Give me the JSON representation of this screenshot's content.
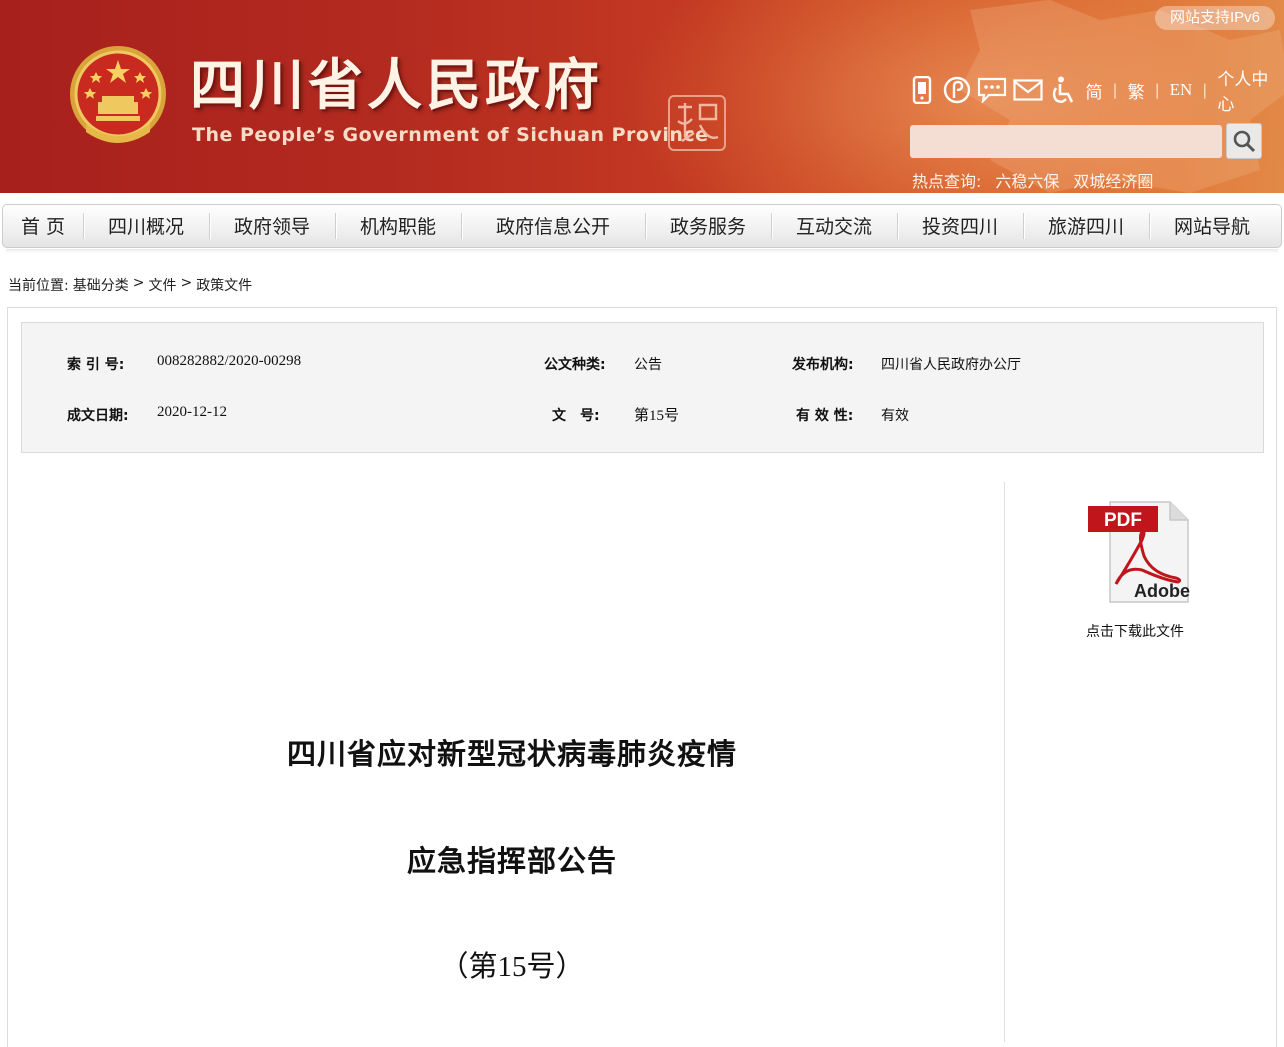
{
  "header": {
    "title": "四川省人民政府",
    "subtitle": "The People’s Government of Sichuan Province",
    "ipv6_badge": "网站支持IPv6",
    "tools": {
      "icons": [
        "mobile-icon",
        "weibo-icon",
        "wechat-icon",
        "mail-icon",
        "accessibility-icon"
      ],
      "lang_simplified": "简",
      "lang_traditional": "繁",
      "lang_english": "EN",
      "personal_center": "个人中心",
      "separator": "|"
    },
    "search": {
      "placeholder": ""
    },
    "hot": {
      "label": "热点查询:",
      "items": [
        "六稳六保",
        "双城经济圈"
      ]
    }
  },
  "nav": {
    "items": [
      "首 页",
      "四川概况",
      "政府领导",
      "机构职能",
      "政府信息公开",
      "政务服务",
      "互动交流",
      "投资四川",
      "旅游四川",
      "网站导航"
    ]
  },
  "breadcrumb": {
    "label": "当前位置:",
    "items": [
      "基础分类",
      "文件",
      "政策文件"
    ],
    "separator": ">"
  },
  "meta": {
    "index_label": "索 引 号:",
    "index_value": "008282882/2020-00298",
    "type_label": "公文种类:",
    "type_value": "公告",
    "issuer_label": "发布机构:",
    "issuer_value": "四川省人民政府办公厅",
    "date_label": "成文日期:",
    "date_value": "2020-12-12",
    "docno_label": "文　号:",
    "docno_value": "第15号",
    "validity_label": "有 效 性:",
    "validity_value": "有效"
  },
  "download": {
    "icon": "pdf-icon",
    "badge": "PDF",
    "brand": "Adobe",
    "label": "点击下载此文件"
  },
  "document": {
    "title_line1": "四川省应对新型冠状病毒肺炎疫情",
    "title_line2": "应急指挥部公告",
    "number": "（第15号）"
  }
}
